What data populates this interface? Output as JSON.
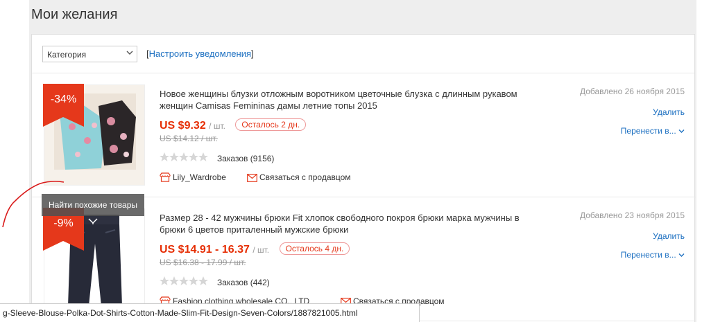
{
  "page_title": "Мои желания",
  "toolbar": {
    "category_value": "Категория",
    "notify_prefix": "[",
    "notify_link": "Настроить уведомления",
    "notify_suffix": "]"
  },
  "items": [
    {
      "discount": "-34%",
      "similar_label": "Найти похожие товары",
      "title": "Новое женщины блузки отложным воротником цветочные блузка с длинным рукавом женщин Camisas Femininas дамы летние топы 2015",
      "price": "US $9.32",
      "unit": "/ шт.",
      "time_left": "Осталось 2 дн.",
      "old_price": "US $14.12 / шт.",
      "orders": "Заказов (9156)",
      "store": "Lily_Wardrobe",
      "contact": "Связаться с продавцом",
      "added": "Добавлено 26 ноября 2015",
      "delete": "Удалить",
      "move": "Перенести в..."
    },
    {
      "discount": "-9%",
      "title": "Размер 28 - 42 мужчины брюки Fit хлопок свободного покроя брюки марка мужчины в брюки 6 цветов приталенный мужские брюки",
      "price": "US $14.91 - 16.37",
      "unit": "/ шт.",
      "time_left": "Осталось 4 дн.",
      "old_price": "US $16.38 - 17.99 / шт.",
      "orders": "Заказов (442)",
      "store": "Fashion clothing wholesale CO., LTD",
      "contact": "Связаться с продавцом",
      "added": "Добавлено 23 ноября 2015",
      "delete": "Удалить",
      "move": "Перенести в..."
    }
  ],
  "status_url": "g-Sleeve-Blouse-Polka-Dot-Shirts-Cotton-Made-Slim-Fit-Design-Seven-Colors/1887821005.html",
  "colors": {
    "accent_red": "#e5381b",
    "link_blue": "#1a6ec0",
    "background": "#eeeeee"
  }
}
